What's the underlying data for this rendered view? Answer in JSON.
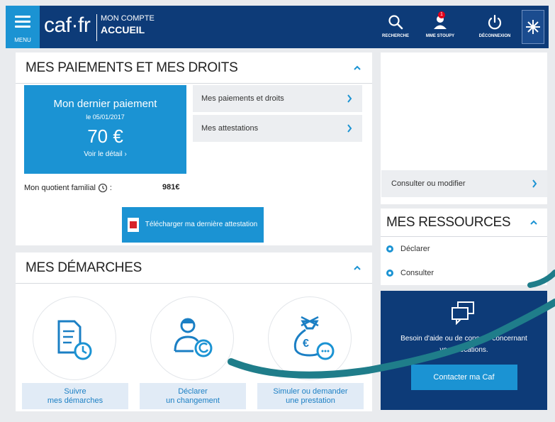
{
  "header": {
    "menu_label": "MENU",
    "logo_text": "caf·fr",
    "account_line1": "MON COMPTE",
    "account_line2": "ACCUEIL",
    "search_label": "RECHERCHE",
    "user_label": "MME STOUPY",
    "notification_count": "1",
    "logout_label": "DÉCONNEXION"
  },
  "payments": {
    "title": "MES PAIEMENTS ET MES DROITS",
    "card_title": "Mon dernier paiement",
    "card_date": "le 05/01/2017",
    "card_amount": "70 €",
    "card_link": "Voir le détail",
    "links": [
      "Mes paiements et droits",
      "Mes attestations"
    ],
    "qf_label": "Mon quotient familial",
    "qf_value": "981€",
    "download_label": "Télécharger ma dernière attestation"
  },
  "demarches": {
    "title": "MES DÉMARCHES",
    "items": [
      {
        "line1": "Suivre",
        "line2": "mes démarches"
      },
      {
        "line1": "Déclarer",
        "line2": "un changement"
      },
      {
        "line1": "Simuler ou demander",
        "line2": "une prestation"
      }
    ]
  },
  "side": {
    "consult_label": "Consulter ou modifier",
    "ressources_title": "MES RESSOURCES",
    "ressources_items": [
      "Déclarer",
      "Consulter"
    ],
    "help_text": "Besoin d'aide ou de conseils concernant vos allocations.",
    "contact_label": "Contacter ma Caf"
  },
  "colors": {
    "navy": "#0d3b78",
    "accent": "#1b93d3",
    "swoosh": "#1f7d8a"
  }
}
